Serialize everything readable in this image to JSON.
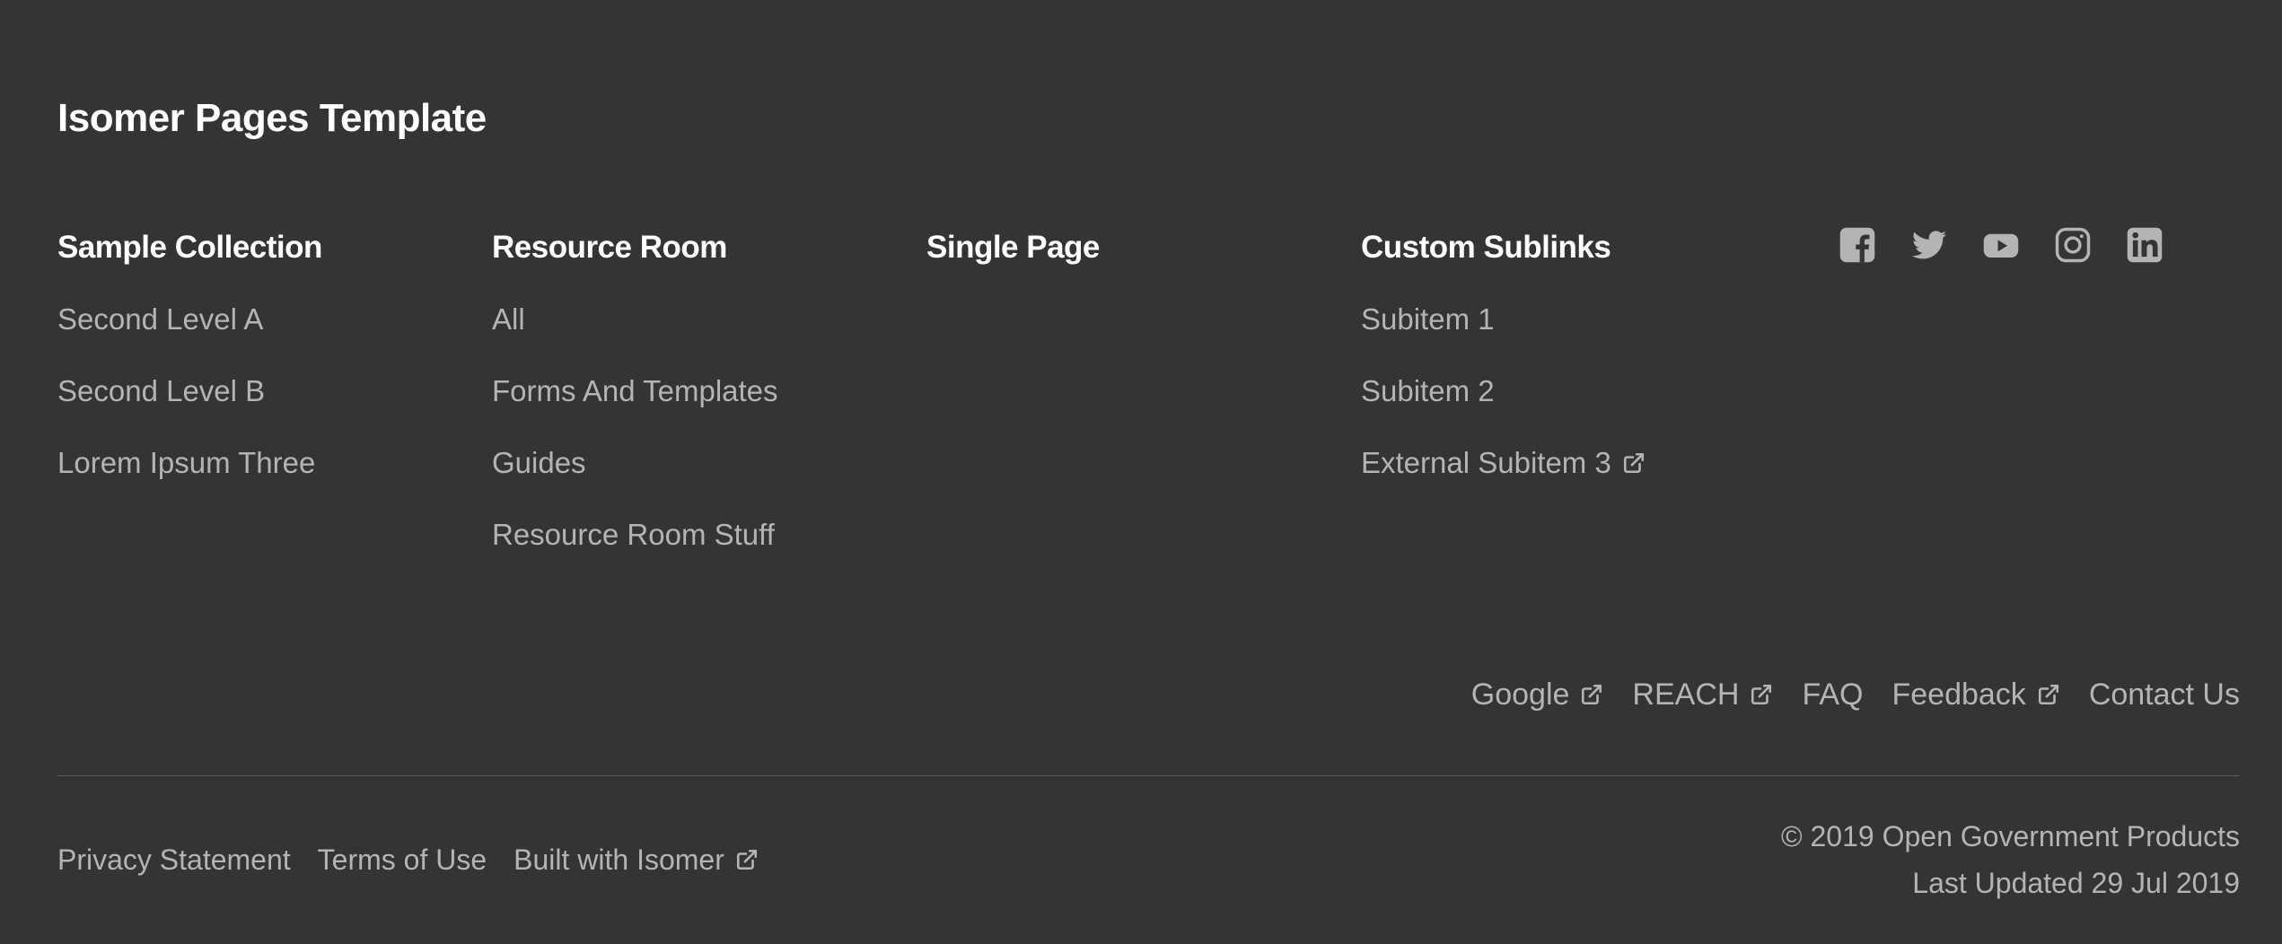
{
  "site": {
    "title": "Isomer Pages Template"
  },
  "colors": {
    "background": "#343434",
    "heading": "#ffffff",
    "link": "#b4b4b4",
    "divider": "#5a5a5a"
  },
  "nav_columns": [
    {
      "heading": "Sample Collection",
      "links": [
        {
          "label": "Second Level A"
        },
        {
          "label": "Second Level B"
        },
        {
          "label": "Lorem Ipsum Three"
        }
      ]
    },
    {
      "heading": "Resource Room",
      "links": [
        {
          "label": "All"
        },
        {
          "label": "Forms And Templates"
        },
        {
          "label": "Guides"
        },
        {
          "label": "Resource Room Stuff"
        }
      ]
    },
    {
      "heading": "Single Page",
      "links": []
    },
    {
      "heading": "Custom Sublinks",
      "links": [
        {
          "label": "Subitem 1"
        },
        {
          "label": "Subitem 2"
        },
        {
          "label": "External Subitem 3",
          "external_icon": "external-link-icon"
        }
      ]
    }
  ],
  "social_icons": [
    "facebook-icon",
    "twitter-icon",
    "youtube-icon",
    "instagram-icon",
    "linkedin-icon"
  ],
  "utility_links": [
    {
      "label": "Google",
      "external_icon": "external-link-icon"
    },
    {
      "label": "REACH",
      "external_icon": "external-link-icon"
    },
    {
      "label": "FAQ"
    },
    {
      "label": "Feedback",
      "external_icon": "external-link-icon"
    },
    {
      "label": "Contact Us"
    }
  ],
  "legal_links": [
    {
      "label": "Privacy Statement"
    },
    {
      "label": "Terms of Use"
    },
    {
      "label": "Built with Isomer",
      "external_icon": "external-link-icon"
    }
  ],
  "copyright": {
    "line1": "© 2019 Open Government Products",
    "line2": "Last Updated 29 Jul 2019"
  }
}
